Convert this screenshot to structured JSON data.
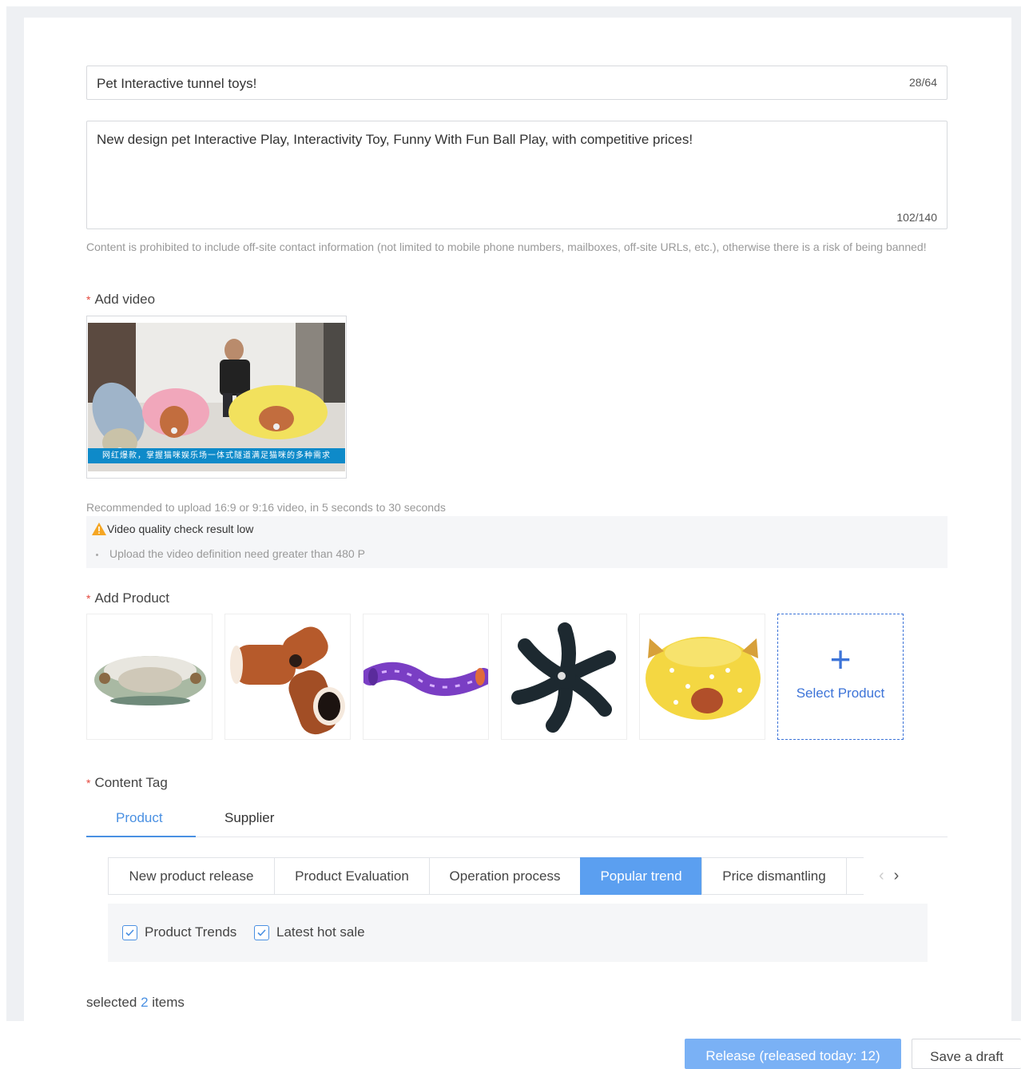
{
  "form": {
    "title_value": "Pet Interactive tunnel toys!",
    "title_counter": "28/64",
    "desc_value": "New design pet Interactive Play, Interactivity Toy, Funny With Fun Ball Play, with competitive prices!",
    "desc_counter": "102/140",
    "notice": "Content is prohibited to include off-site contact information (not limited to mobile phone numbers, mailboxes, off-site URLs, etc.), otherwise there is a risk of being banned!"
  },
  "video": {
    "label": "Add video",
    "caption": "网红爆款，掌握猫咪娱乐场一体式隧道满足猫咪的多种需求",
    "hint": "Recommended to upload 16:9 or 9:16 video, in 5 seconds to 30 seconds",
    "warning_title": "Video quality check result low",
    "warning_item": "Upload the video definition need greater than 480 P"
  },
  "products": {
    "label": "Add Product",
    "select_label": "Select Product",
    "items": [
      {
        "name": "round-cat-bed-tunnel"
      },
      {
        "name": "y-shaped-brown-tunnel"
      },
      {
        "name": "purple-crinkle-tunnel"
      },
      {
        "name": "star-shaped-black-tunnel"
      },
      {
        "name": "yellow-polka-dot-bed"
      }
    ]
  },
  "content_tag": {
    "label": "Content Tag",
    "tabs": [
      "Product",
      "Supplier"
    ],
    "tags": [
      "New product release",
      "Product Evaluation",
      "Operation process",
      "Popular trend",
      "Price dismantling"
    ],
    "active_tag": "Popular trend",
    "checkboxes": [
      "Product Trends",
      "Latest hot sale"
    ]
  },
  "selection": {
    "prefix": "selected",
    "count": "2",
    "suffix": "items"
  },
  "footer": {
    "release_label": "Release (released today: 12)",
    "draft_label": "Save a draft"
  },
  "colors": {
    "accent": "#4a90e2",
    "required": "#e5483d",
    "warning": "#f5a623",
    "release_button": "#7ab1f5"
  }
}
